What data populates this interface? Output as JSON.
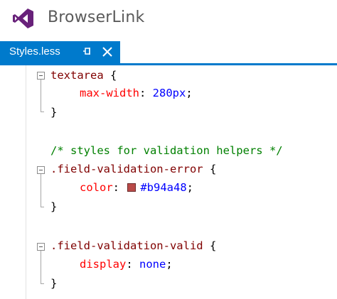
{
  "app": {
    "title": "BrowserLink",
    "logo_icon": "visual-studio-icon",
    "logo_color": "#68217a"
  },
  "tab": {
    "label": "Styles.less",
    "active": true,
    "accent_color": "#007acc",
    "pin_icon": "pin-icon",
    "close_icon": "close-icon"
  },
  "colors": {
    "selector": "#800000",
    "property": "#ff0000",
    "value": "#0000ff",
    "comment": "#008000",
    "squiggle": "#36a336"
  },
  "code": {
    "l1": {
      "selector": "textarea",
      "brace": " {"
    },
    "l2": {
      "property": "max-width",
      "colon": ": ",
      "value": "280px",
      "semi": ";"
    },
    "l3": {
      "brace": "}"
    },
    "l5": {
      "comment": "/* styles for validation helpers */"
    },
    "l6": {
      "selector": ".field-validation-error",
      "brace": " {"
    },
    "l7": {
      "property": "color",
      "colon": ": ",
      "value": "#b94a48",
      "semi": ";",
      "swatch_color": "#b94a48"
    },
    "l8": {
      "brace": "}"
    },
    "l10": {
      "selector": ".field-validation-valid",
      "brace": " {"
    },
    "l11": {
      "property": "display",
      "colon": ": ",
      "value": "none",
      "semi": ";"
    },
    "l12": {
      "brace": "}"
    }
  }
}
